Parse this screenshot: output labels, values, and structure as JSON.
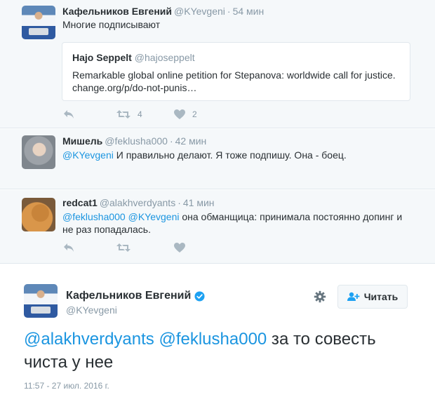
{
  "tweets": [
    {
      "name": "Кафельников Евгений",
      "handle": "@KYevgeni",
      "time": "54 мин",
      "text": "Многие подписывают",
      "quote": {
        "name": "Hajo Seppelt",
        "handle": "@hajoseppelt",
        "text": "Remarkable global online petition for Stepanova: worldwide call for justice. change.org/p/do-not-punis…"
      },
      "retweets": "4",
      "likes": "2"
    },
    {
      "name": "Мишель",
      "handle": "@feklusha000",
      "time": "42 мин",
      "mention": "@KYevgeni",
      "text": " И правильно делают. Я тоже подпишу. Она - боец."
    },
    {
      "name": "redcat1",
      "handle": "@alakhverdyants",
      "time": "41 мин",
      "mention1": "@feklusha000",
      "mention2": "@KYevgeni",
      "text": " она обманщица: принимала постоянно допинг и не раз попадалась."
    }
  ],
  "main": {
    "name": "Кафельников Евгений",
    "handle": "@KYevgeni",
    "follow_label": "Читать",
    "mention1": "@alakhverdyants",
    "mention2": "@feklusha000",
    "text": " за то совесть чиста у нее",
    "timestamp": "11:57 - 27 июл. 2016 г."
  },
  "colors": {
    "link": "#1b95e0",
    "meta": "#8899a6",
    "text": "#292f33",
    "verified": "#1da1f2",
    "thread_bg": "#f5f8fa"
  },
  "icons": [
    "reply-icon",
    "retweet-icon",
    "like-icon",
    "verified-icon",
    "gear-icon",
    "follow-icon"
  ]
}
